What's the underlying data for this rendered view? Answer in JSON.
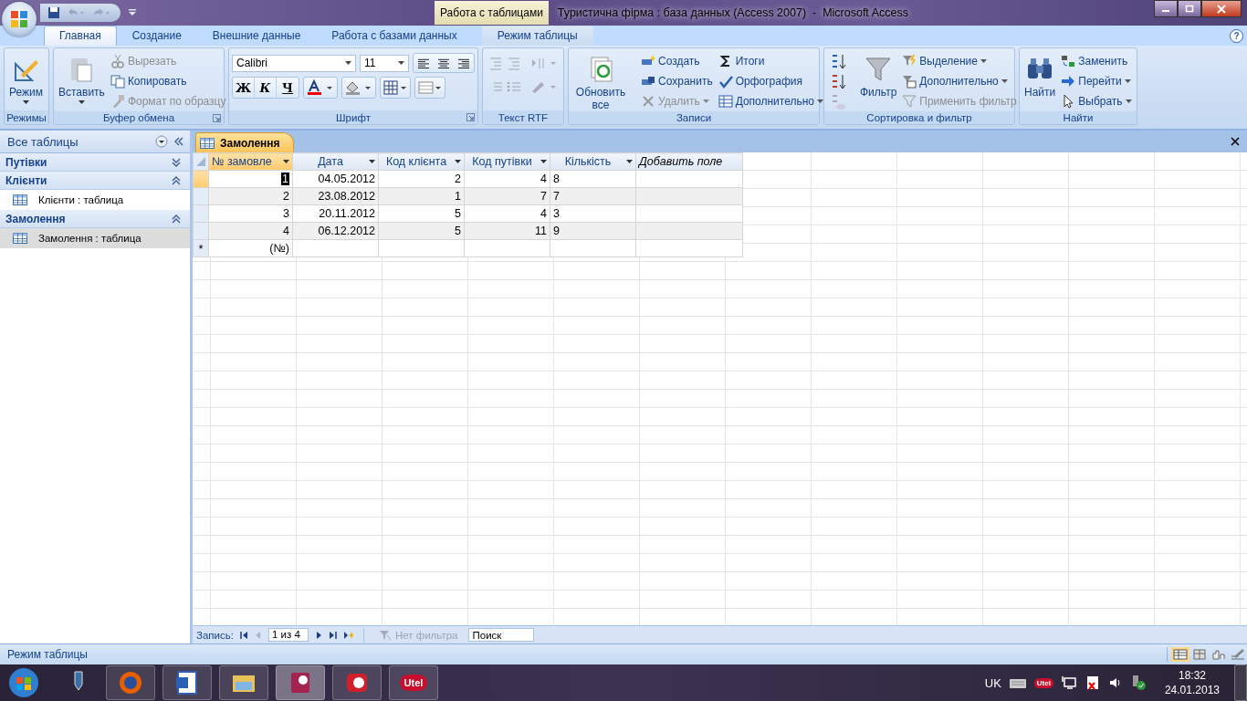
{
  "title_bar": {
    "context_tab": "Работа с таблицами",
    "title": "Туристична фірма : база данных (Access 2007)  -  Microsoft Access"
  },
  "ribbon_tabs": [
    {
      "label": "Главная",
      "selected": true
    },
    {
      "label": "Создание",
      "selected": false
    },
    {
      "label": "Внешние данные",
      "selected": false
    },
    {
      "label": "Работа с базами данных",
      "selected": false
    },
    {
      "label": "Режим таблицы",
      "selected": false
    }
  ],
  "help_button": "?",
  "ribbon_groups": [
    {
      "title": "Режимы",
      "commands": [
        {
          "label": "Режим",
          "disabled": false
        }
      ]
    },
    {
      "title": "Буфер обмена",
      "commands": [
        {
          "label": "Вставить",
          "disabled": false
        },
        {
          "label": "Вырезать",
          "disabled": true
        },
        {
          "label": "Копировать",
          "disabled": false
        },
        {
          "label": "Формат по образцу",
          "disabled": true
        }
      ]
    },
    {
      "title": "Шрифт",
      "font": "Calibri",
      "size": "11",
      "commands": [
        {
          "label": "Ж",
          "disabled": false
        },
        {
          "label": "К",
          "disabled": false
        },
        {
          "label": "Ч",
          "disabled": false
        }
      ]
    },
    {
      "title": "Текст RTF"
    },
    {
      "title": "Записи",
      "commands": [
        {
          "label": "Обновить все",
          "disabled": false
        },
        {
          "label": "Создать",
          "disabled": false
        },
        {
          "label": "Сохранить",
          "disabled": false
        },
        {
          "label": "Удалить",
          "disabled": true
        },
        {
          "label": "Итоги",
          "disabled": false
        },
        {
          "label": "Орфография",
          "disabled": false
        },
        {
          "label": "Дополнительно",
          "disabled": false
        }
      ]
    },
    {
      "title": "Сортировка и фильтр",
      "commands": [
        {
          "label": "Фильтр",
          "disabled": false
        },
        {
          "label": "Выделение",
          "disabled": false
        },
        {
          "label": "Дополнительно",
          "disabled": false
        },
        {
          "label": "Применить фильтр",
          "disabled": true
        }
      ]
    },
    {
      "title": "Найти",
      "commands": [
        {
          "label": "Найти",
          "disabled": false
        },
        {
          "label": "Заменить",
          "disabled": false
        },
        {
          "label": "Перейти",
          "disabled": false
        },
        {
          "label": "Выбрать",
          "disabled": false
        }
      ]
    }
  ],
  "nav_pane": {
    "title": "Все таблицы",
    "groups": [
      {
        "title": "Путівки",
        "expanded": false
      },
      {
        "title": "Клієнти",
        "expanded": true,
        "items": [
          {
            "label": "Клієнти : таблица",
            "selected": false
          }
        ]
      },
      {
        "title": "Замолення",
        "expanded": true,
        "items": [
          {
            "label": "Замолення : таблица",
            "selected": true
          }
        ]
      }
    ]
  },
  "document_tab": "Замолення",
  "table": {
    "columns": [
      {
        "label": "№ замовле",
        "kind": "number"
      },
      {
        "label": "Дата",
        "kind": "number"
      },
      {
        "label": "Код клієнта",
        "kind": "number"
      },
      {
        "label": "Код путівки",
        "kind": "number"
      },
      {
        "label": "Кількість",
        "kind": "text"
      }
    ],
    "add_field": "Добавить поле",
    "rows": [
      {
        "selected": true,
        "cells": [
          "1",
          "04.05.2012",
          "2",
          "4",
          "8"
        ]
      },
      {
        "selected": false,
        "cells": [
          "2",
          "23.08.2012",
          "1",
          "7",
          "7"
        ]
      },
      {
        "selected": false,
        "cells": [
          "3",
          "20.11.2012",
          "5",
          "4",
          "3"
        ]
      },
      {
        "selected": false,
        "cells": [
          "4",
          "06.12.2012",
          "5",
          "11",
          "9"
        ]
      }
    ],
    "new_row": {
      "marker": "*",
      "cells": [
        "(№)"
      ]
    }
  },
  "record_nav": {
    "label": "Запись:",
    "position": "1 из 4",
    "filter": "Нет фильтра",
    "filter_disabled": true,
    "search_placeholder": "Поиск"
  },
  "status_bar": {
    "text": "Режим таблицы"
  },
  "taskbar": {
    "apps": [
      {
        "selected": false
      },
      {
        "selected": false
      },
      {
        "selected": false
      },
      {
        "selected": false
      },
      {
        "selected": true
      },
      {
        "selected": false
      },
      {
        "selected": false,
        "label": "Utel"
      }
    ],
    "language": "UK",
    "tray_label": "Utel",
    "time": "18:32",
    "date": "24.01.2013"
  }
}
